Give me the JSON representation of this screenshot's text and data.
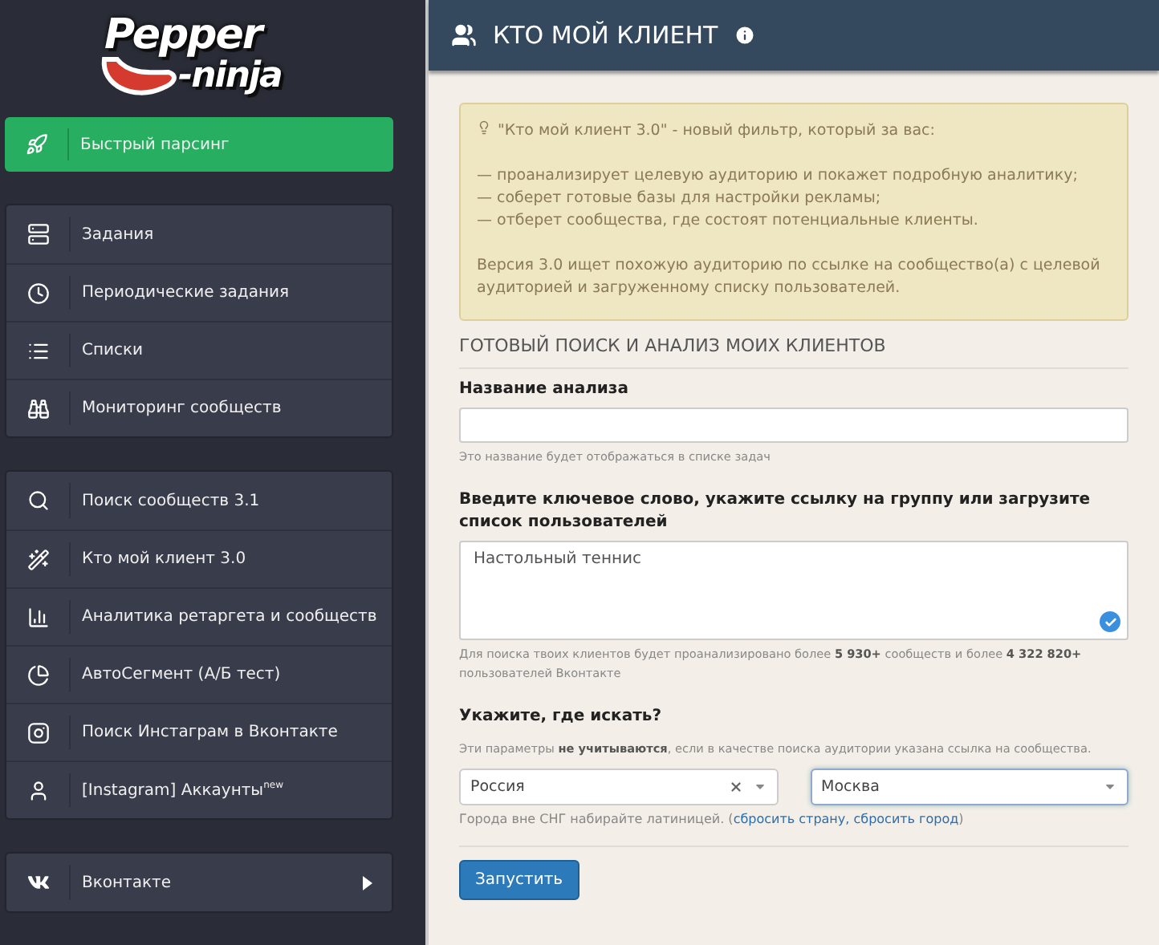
{
  "logo": {
    "line1": "Pepper",
    "line2": "-ninja"
  },
  "sidebar": {
    "groups": [
      {
        "items": [
          {
            "label": "Быстрый парсинг",
            "selected": true,
            "expandable": false
          }
        ]
      },
      {
        "items": [
          {
            "label": "Задания",
            "selected": false,
            "expandable": false
          },
          {
            "label": "Периодические задания",
            "selected": false,
            "expandable": false
          },
          {
            "label": "Списки",
            "selected": false,
            "expandable": false
          },
          {
            "label": "Мониторинг сообществ",
            "selected": false,
            "expandable": false
          }
        ]
      },
      {
        "items": [
          {
            "label": "Поиск сообществ 3.1",
            "selected": false,
            "expandable": false
          },
          {
            "label": "Кто мой клиент 3.0",
            "selected": false,
            "expandable": false
          },
          {
            "label": "Аналитика ретаргета и сообществ",
            "selected": false,
            "expandable": false
          },
          {
            "label": "АвтоСегмент (А/Б тест)",
            "selected": false,
            "expandable": false
          },
          {
            "label": "Поиск Инстаграм в Вконтакте",
            "selected": false,
            "expandable": false
          },
          {
            "label": "[Instagram] Аккаунты$^{new}$",
            "selected": false,
            "expandable": false
          }
        ]
      },
      {
        "items": [
          {
            "label": "Вконтакте",
            "selected": false,
            "expandable": true
          }
        ]
      }
    ]
  },
  "header": {
    "title": "КТО МОЙ КЛИЕНТ"
  },
  "notice": {
    "intro": "\"Кто мой клиент 3.0\" - новый фильтр, который за вас:",
    "bullets": [
      "— проанализирует целевую аудиторию и покажет подробную аналитику;",
      "— соберет готовые базы для настройки рекламы;",
      "— отберет сообщества, где состоят потенциальные клиенты."
    ],
    "footer": "Версия 3.0 ищет похожую аудиторию по ссылке на сообщество(а) с целевой аудиторией и загруженному списку пользователей."
  },
  "form": {
    "section_title": "ГОТОВЫЙ ПОИСК И АНАЛИЗ МОИХ КЛИЕНТОВ",
    "name_field": {
      "label": "Название анализа",
      "hint": "Это название будет отображаться в списке задач"
    },
    "query_field": {
      "label": "Введите ключевое слово, укажите ссылку на группу или загрузите список пользователей",
      "value": "Настольный теннис",
      "valid": true,
      "hint": "Для поиска твоих клиентов будет проанализировано более **5 930+** сообществ и более **4 322 820+** пользователей Вконтакте"
    },
    "location": {
      "label": "Укажите, где искать?",
      "note": "Эти параметры **не учитываются**, если в качестве поиска аудитории указана ссылка на сообщества.",
      "country": {
        "value": "Россия",
        "clearable": true,
        "focused": false
      },
      "city": {
        "value": "Москва",
        "clearable": false,
        "focused": true
      },
      "hint_prefix": "Города вне СНГ набирайте латиницей. (",
      "links": [
        "сбросить страну",
        "сбросить город"
      ],
      "link_separator": ", ",
      "hint_suffix": ")"
    },
    "submit": "Запустить"
  }
}
